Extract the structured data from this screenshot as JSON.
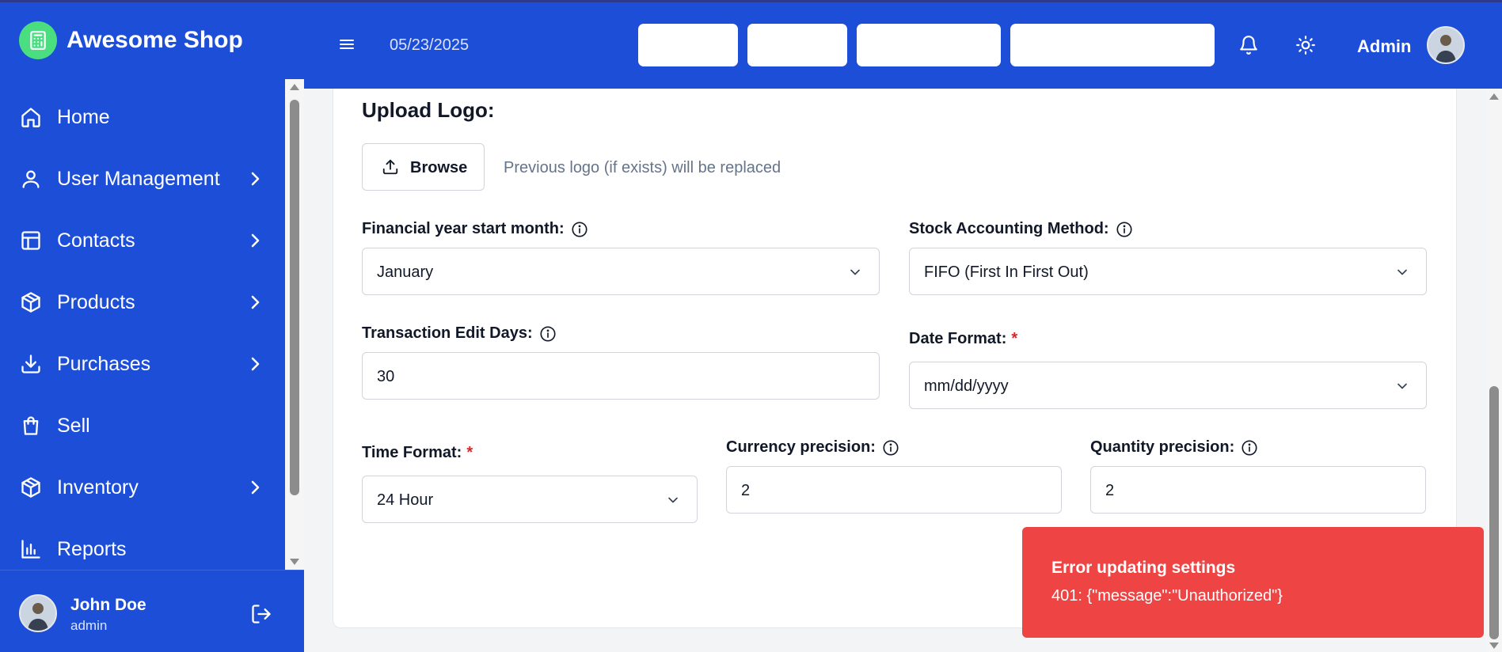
{
  "brand": {
    "name": "Awesome Shop",
    "logo_icon": "calculator-icon",
    "accent": "#4ade80"
  },
  "theme": {
    "primary": "#1d4ed8",
    "error": "#ef4444"
  },
  "sidebar": {
    "items": [
      {
        "label": "Home",
        "icon": "home-icon",
        "has_submenu": false
      },
      {
        "label": "User Management",
        "icon": "user-icon",
        "has_submenu": true
      },
      {
        "label": "Contacts",
        "icon": "layout-icon",
        "has_submenu": true
      },
      {
        "label": "Products",
        "icon": "package-icon",
        "has_submenu": true
      },
      {
        "label": "Purchases",
        "icon": "download-icon",
        "has_submenu": true
      },
      {
        "label": "Sell",
        "icon": "shopping-bag-icon",
        "has_submenu": false
      },
      {
        "label": "Inventory",
        "icon": "package-icon",
        "has_submenu": true
      },
      {
        "label": "Reports",
        "icon": "bar-chart-icon",
        "has_submenu": false
      }
    ],
    "user": {
      "name": "John Doe",
      "role": "admin"
    }
  },
  "header": {
    "date": "05/23/2025",
    "user_label": "Admin"
  },
  "form": {
    "upload_logo_title": "Upload Logo:",
    "browse_label": "Browse",
    "browse_hint": "Previous logo (if exists) will be replaced",
    "financial_year": {
      "label": "Financial year start month:",
      "value": "January"
    },
    "stock_method": {
      "label": "Stock Accounting Method:",
      "value": "FIFO (First In First Out)"
    },
    "edit_days": {
      "label": "Transaction Edit Days:",
      "value": "30"
    },
    "date_format": {
      "label": "Date Format:",
      "required": "*",
      "value": "mm/dd/yyyy"
    },
    "time_format": {
      "label": "Time Format:",
      "required": "*",
      "value": "24 Hour"
    },
    "currency_precision": {
      "label": "Currency precision:",
      "value": "2"
    },
    "quantity_precision": {
      "label": "Quantity precision:",
      "value": "2"
    }
  },
  "toast": {
    "title": "Error updating settings",
    "message": "401: {\"message\":\"Unauthorized\"}"
  }
}
